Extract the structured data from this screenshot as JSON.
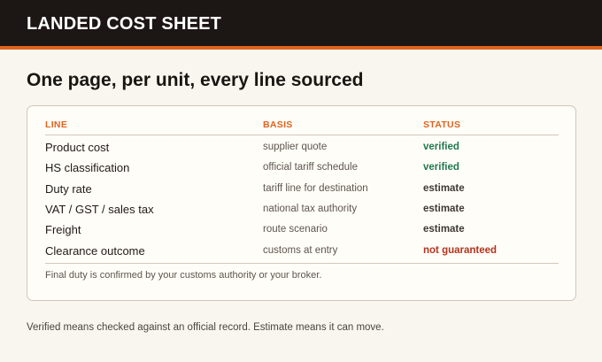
{
  "app": {
    "title": "LANDED COST SHEET"
  },
  "page": {
    "title": "One page, per unit, every line sourced",
    "footnote": "Verified means checked against an official record. Estimate means it can move."
  },
  "table": {
    "columns": {
      "line": "LINE",
      "basis": "BASIS",
      "status": "STATUS"
    },
    "rows": [
      {
        "line": "Product cost",
        "basis": "supplier quote",
        "status": "verified",
        "status_color": "#1f7a4d"
      },
      {
        "line": "HS classification",
        "basis": "official tariff schedule",
        "status": "verified",
        "status_color": "#1f7a4d"
      },
      {
        "line": "Duty rate",
        "basis": "tariff line for destination",
        "status": "estimate",
        "status_color": "#3d3833"
      },
      {
        "line": "VAT / GST / sales tax",
        "basis": "national tax authority",
        "status": "estimate",
        "status_color": "#3d3833"
      },
      {
        "line": "Freight",
        "basis": "route scenario",
        "status": "estimate",
        "status_color": "#3d3833"
      },
      {
        "line": "Clearance outcome",
        "basis": "customs at entry",
        "status": "not guaranteed",
        "status_color": "#b3331c"
      }
    ],
    "footnote": "Final duty is confirmed by your customs authority or your broker."
  },
  "colors": {
    "accent": "#e0631d",
    "header_bg": "#1c1714",
    "verified": "#1f7a4d",
    "estimate": "#3d3833",
    "not_guaranteed": "#b3331c"
  }
}
